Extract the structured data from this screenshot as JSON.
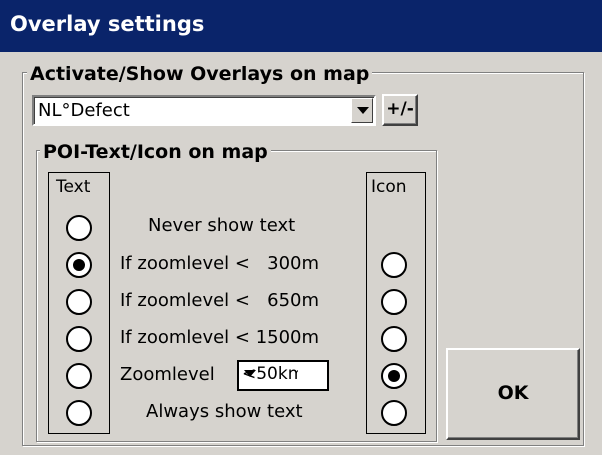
{
  "window": {
    "title": "Overlay settings"
  },
  "overlays": {
    "group_label": "Activate/Show Overlays on map",
    "selected_overlay": "NL°Defect",
    "toggle_button_label": "+/-"
  },
  "poi": {
    "group_label": "POI-Text/Icon on map",
    "text_column_header": "Text",
    "icon_column_header": "Icon",
    "options": [
      {
        "label": "Never show text",
        "text_selected": false,
        "icon_selected": null
      },
      {
        "label": "If zoomlevel <   300m",
        "text_selected": true,
        "icon_selected": false
      },
      {
        "label": "If zoomlevel <   650m",
        "text_selected": false,
        "icon_selected": false
      },
      {
        "label": "If zoomlevel < 1500m",
        "text_selected": false,
        "icon_selected": false
      },
      {
        "label": "Zoomlevel",
        "text_selected": false,
        "icon_selected": true
      },
      {
        "label": "Always show text",
        "text_selected": false,
        "icon_selected": false
      }
    ],
    "zoomlevel_select_value": "<50km"
  },
  "ok_button_label": "OK"
}
